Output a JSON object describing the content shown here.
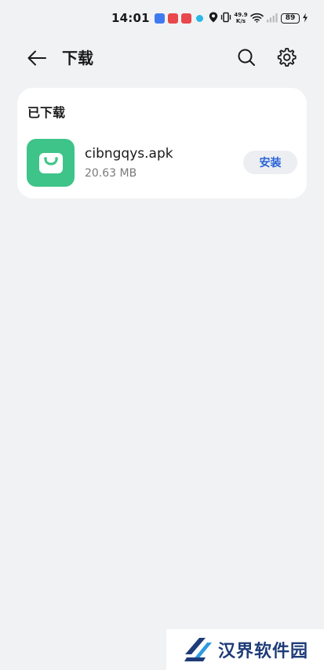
{
  "status_bar": {
    "time": "14:01",
    "net_speed_value": "49.9",
    "net_speed_unit": "K/s",
    "battery": "89",
    "notification_icons": [
      "blue-app-icon",
      "red-app-icon",
      "red-app-icon",
      "cyan-app-icon"
    ],
    "system_icons": [
      "location-icon",
      "vibrate-icon",
      "wifi-icon",
      "signal-icon",
      "charging-icon"
    ]
  },
  "header": {
    "title": "下载",
    "icons": [
      "back-arrow-icon",
      "search-icon",
      "gear-icon"
    ]
  },
  "downloaded_section": {
    "title": "已下载",
    "items": [
      {
        "file_name": "cibngqys.apk",
        "file_size": "20.63 MB",
        "action_label": "安装",
        "icon": "shopping-bag-icon",
        "icon_color": "#3ec489"
      }
    ]
  },
  "watermark": {
    "text": "汉界软件园"
  },
  "colors": {
    "background": "#f1f2f4",
    "card": "#ffffff",
    "accent": "#2a64d8",
    "app_icon": "#3ec489"
  }
}
